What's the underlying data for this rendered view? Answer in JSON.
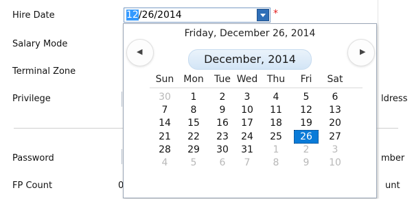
{
  "form": {
    "hire_date_label": "Hire Date",
    "salary_mode_label": "Salary Mode",
    "terminal_zone_label": "Terminal Zone",
    "privilege_label": "Privilege",
    "password_label": "Password",
    "fp_count_label": "FP Count",
    "fp_count_value": "0",
    "hire_date_value_selected": "12",
    "hire_date_value_rest": "/26/2014",
    "required_mark": "*",
    "address_partial": "ldress",
    "number_partial": "mber",
    "count_partial": "unt"
  },
  "calendar": {
    "today_text": "Friday, December 26, 2014",
    "month_title": "December, 2014",
    "prev_glyph": "◀",
    "next_glyph": "▶",
    "weekdays": [
      "Sun",
      "Mon",
      "Tue",
      "Wed",
      "Thu",
      "Fri",
      "Sat"
    ],
    "weeks": [
      [
        "30",
        "1",
        "2",
        "3",
        "4",
        "5",
        "6"
      ],
      [
        "7",
        "8",
        "9",
        "10",
        "11",
        "12",
        "13"
      ],
      [
        "14",
        "15",
        "16",
        "17",
        "18",
        "19",
        "20"
      ],
      [
        "21",
        "22",
        "23",
        "24",
        "25",
        "26",
        "27"
      ],
      [
        "28",
        "29",
        "30",
        "31",
        "1",
        "2",
        "3"
      ],
      [
        "4",
        "5",
        "6",
        "7",
        "8",
        "9",
        "10"
      ]
    ],
    "muted": [
      [
        true,
        false,
        false,
        false,
        false,
        false,
        false
      ],
      [
        false,
        false,
        false,
        false,
        false,
        false,
        false
      ],
      [
        false,
        false,
        false,
        false,
        false,
        false,
        false
      ],
      [
        false,
        false,
        false,
        false,
        false,
        false,
        false
      ],
      [
        false,
        false,
        false,
        false,
        true,
        true,
        true
      ],
      [
        true,
        true,
        true,
        true,
        true,
        true,
        true
      ]
    ],
    "selected_week": 3,
    "selected_day": 5
  }
}
